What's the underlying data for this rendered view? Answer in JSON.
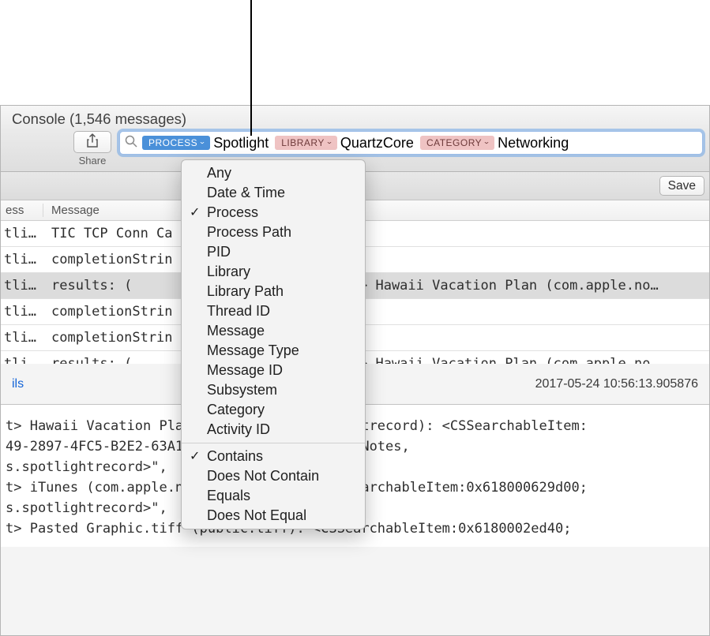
{
  "window": {
    "title": "Console (1,546 messages)"
  },
  "toolbar": {
    "share_label": "Share",
    "save_label": "Save",
    "tokens": [
      {
        "key": "PROCESS",
        "value": "Spotlight",
        "active": true
      },
      {
        "key": "LIBRARY",
        "value": "QuartzCore",
        "active": false
      },
      {
        "key": "CATEGORY",
        "value": "Networking",
        "active": false
      }
    ]
  },
  "columns": {
    "c1": "ess",
    "c2": "Message"
  },
  "rows": [
    {
      "p": "tli…",
      "pre": "TIC TCP Conn Ca",
      "post": "]",
      "selected": false
    },
    {
      "p": "tli…",
      "pre": "completionStrin",
      "post": "",
      "selected": false
    },
    {
      "p": "tli…",
      "pre": "results: (",
      "post": "> Hawaii Vacation Plan (com.apple.no…",
      "selected": true
    },
    {
      "p": "tli…",
      "pre": "completionStrin",
      "post": "",
      "selected": false
    },
    {
      "p": "tli…",
      "pre": "completionStrin",
      "post": "",
      "selected": false
    },
    {
      "p": "tli…",
      "pre": "results: (",
      "post": "> Hawaii Vacation Plan (com.apple.no…",
      "selected": false
    }
  ],
  "detail": {
    "left": "ils",
    "timestamp": "2017-05-24 10:56:13.905876"
  },
  "log": "t> Hawaii Vacation Pla                 tlightrecord): <CSSearchableItem:\n49-2897-4FC5-B2E2-63A1               .apple.Notes,\ns.spotlightrecord>\",\nt> iTunes (com.apple.n                 <CSSearchableItem:0x618000629d00;\ns.spotlightrecord>\",\nt> Pasted Graphic.tiff (public.tiff): <CSSearchableItem:0x6180002ed40;",
  "menu": {
    "groups": [
      [
        "Any",
        "Date & Time",
        "Process",
        "Process Path",
        "PID",
        "Library",
        "Library Path",
        "Thread ID",
        "Message",
        "Message Type",
        "Message ID",
        "Subsystem",
        "Category",
        "Activity ID"
      ],
      [
        "Contains",
        "Does Not Contain",
        "Equals",
        "Does Not Equal"
      ]
    ],
    "checked": [
      "Process",
      "Contains"
    ]
  }
}
